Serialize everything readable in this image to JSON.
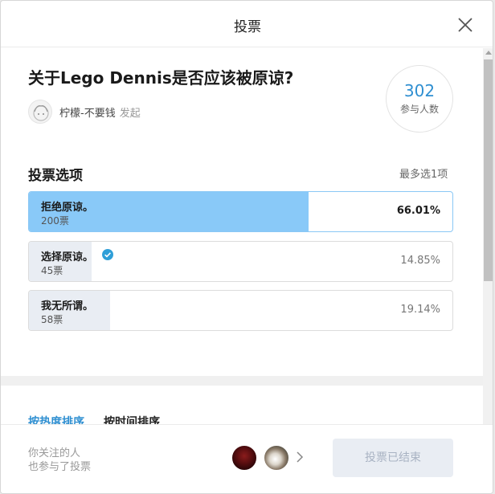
{
  "dialog": {
    "title": "投票"
  },
  "poll": {
    "question": "关于Lego Dennis是否应该被原谅?",
    "author": "柠檬-不要钱",
    "author_suffix": "发起",
    "participant_count": "302",
    "participant_label": "参与人数"
  },
  "options_section": {
    "title": "投票选项",
    "limit": "最多选1项",
    "items": [
      {
        "label": "拒绝原谅。",
        "votes": "200票",
        "percent": "66.01%",
        "share": 0.6601,
        "selected": false
      },
      {
        "label": "选择原谅。",
        "votes": "45票",
        "percent": "14.85%",
        "share": 0.1485,
        "selected": true
      },
      {
        "label": "我无所谓。",
        "votes": "58票",
        "percent": "19.14%",
        "share": 0.1914,
        "selected": false
      }
    ]
  },
  "sort": {
    "tabs": [
      "按热度排序",
      "按时间排序"
    ],
    "active": 0
  },
  "footer": {
    "line1": "你关注的人",
    "line2": "也参与了投票",
    "button": "投票已结束"
  },
  "colors": {
    "accent": "#2f8fd1",
    "top_option_fill": "#89c9f8",
    "option_fill": "#e9edf3"
  },
  "icons": [
    "close-icon",
    "check-icon",
    "chevron-right-icon"
  ]
}
